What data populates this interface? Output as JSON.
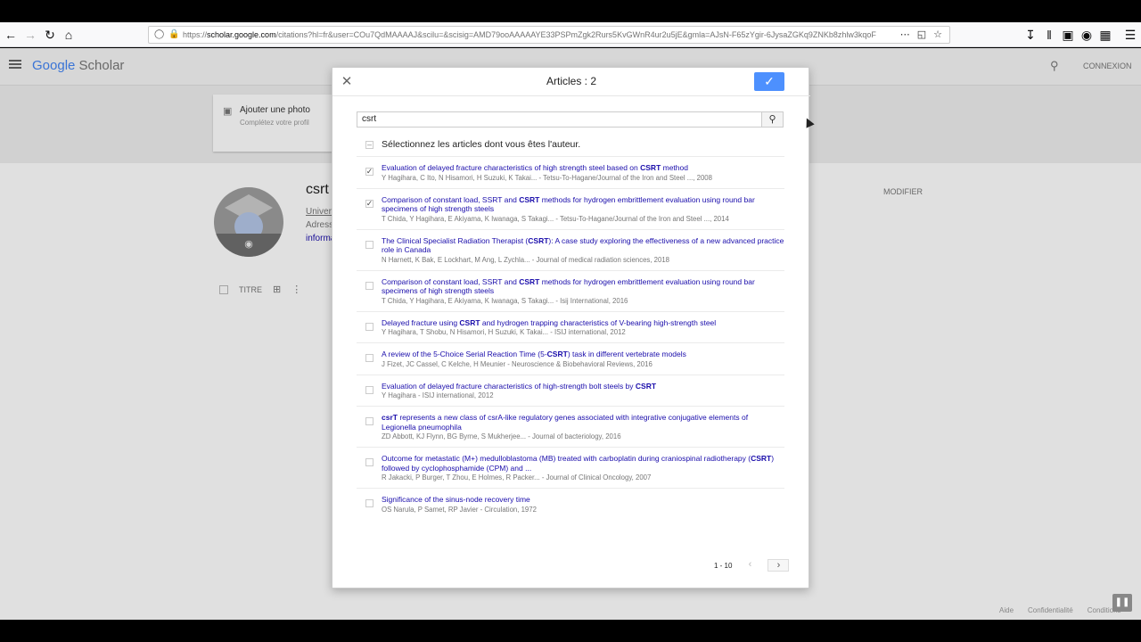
{
  "browser": {
    "url_domain": "scholar.google.com",
    "url_prefix": "https://",
    "url_rest": "/citations?hl=fr&user=COu7QdMAAAAJ&scilu=&scisig=AMD79ooAAAAAYE33PSPmZgk2Rurs5KvGWnR4ur2u5jE&gmla=AJsN-F65zYgir-6JysaZGKq9ZNKb8zhlw3kqoF"
  },
  "header": {
    "logo_google": "Google",
    "logo_scholar": "Scholar",
    "connexion": "CONNEXION"
  },
  "profile": {
    "add_photo": "Ajouter une photo",
    "complete_profile": "Complétez votre profil",
    "name": "csrt",
    "line1": "Univers",
    "line2": "Adress",
    "line3": "informa",
    "modifier": "MODIFIER",
    "titre": "TITRE"
  },
  "dialog": {
    "title": "Articles : 2",
    "search_value": "csrt",
    "select_all_text": "Sélectionnez les articles dont vous êtes l'auteur.",
    "pager_range": "1 - 10",
    "articles": [
      {
        "pre": "Evaluation of delayed fracture characteristics of high strength steel based on ",
        "bold": "CSRT",
        "post": " method",
        "meta": "Y Hagihara, C Ito, N Hisamori, H Suzuki, K Takai... - Tetsu-To-Hagane/Journal of the Iron and Steel ..., 2008",
        "checked": true
      },
      {
        "pre": "Comparison of constant load, SSRT and ",
        "bold": "CSRT",
        "post": " methods for hydrogen embrittlement evaluation using round bar specimens of high strength steels",
        "meta": "T Chida, Y Hagihara, E Akiyama, K Iwanaga, S Takagi... - Tetsu-To-Hagane/Journal of the Iron and Steel ..., 2014",
        "checked": true
      },
      {
        "pre": "The Clinical Specialist Radiation Therapist (",
        "bold": "CSRT",
        "post": "): A case study exploring the effectiveness of a new advanced practice role in Canada",
        "meta": "N Harnett, K Bak, E Lockhart, M Ang, L Zychla... - Journal of medical radiation sciences, 2018",
        "checked": false
      },
      {
        "pre": "Comparison of constant load, SSRT and ",
        "bold": "CSRT",
        "post": " methods for hydrogen embrittlement evaluation using round bar specimens of high strength steels",
        "meta": "T Chida, Y Hagihara, E Akiyama, K Iwanaga, S Takagi... - Isij International, 2016",
        "checked": false
      },
      {
        "pre": "Delayed fracture using ",
        "bold": "CSRT",
        "post": " and hydrogen trapping characteristics of V-bearing high-strength steel",
        "meta": "Y Hagihara, T Shobu, N Hisamori, H Suzuki, K Takai... - ISIJ international, 2012",
        "checked": false
      },
      {
        "pre": "A review of the 5-Choice Serial Reaction Time (5-",
        "bold": "CSRT",
        "post": ") task in different vertebrate models",
        "meta": "J Fizet, JC Cassel, C Kelche, H Meunier - Neuroscience & Biobehavioral Reviews, 2016",
        "checked": false
      },
      {
        "pre": "Evaluation of delayed fracture characteristics of high-strength bolt steels by ",
        "bold": "CSRT",
        "post": "",
        "meta": "Y Hagihara - ISIJ international, 2012",
        "checked": false
      },
      {
        "pre": "",
        "bold": "csrT",
        "post": " represents a new class of csrA-like regulatory genes associated with integrative conjugative elements of Legionella pneumophila",
        "meta": "ZD Abbott, KJ Flynn, BG Byrne, S Mukherjee... - Journal of bacteriology, 2016",
        "checked": false
      },
      {
        "pre": "Outcome for metastatic (M+) medulloblastoma (MB) treated with carboplatin during craniospinal radiotherapy (",
        "bold": "CSRT",
        "post": ") followed by cyclophosphamide (CPM) and ...",
        "meta": "R Jakacki, P Burger, T Zhou, E Holmes, R Packer... - Journal of Clinical Oncology, 2007",
        "checked": false
      },
      {
        "pre": "Significance of the sinus-node recovery time",
        "bold": "",
        "post": "",
        "meta": "OS Narula, P Samet, RP Javier - Circulation, 1972",
        "checked": false
      }
    ]
  },
  "footer": {
    "aide": "Aide",
    "confidentialite": "Confidentialité",
    "conditions": "Conditions"
  }
}
